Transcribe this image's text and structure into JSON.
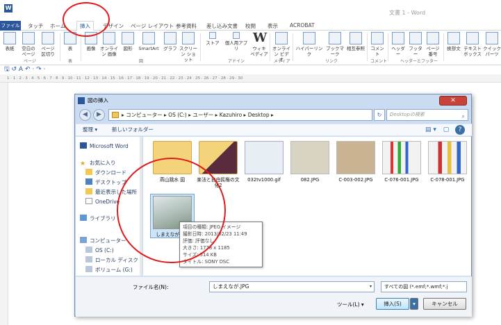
{
  "window": {
    "app_icon": "W",
    "title": "文書 1 - Word"
  },
  "tabs": [
    "ファイル",
    "タッチ",
    "ホーム",
    "挿入",
    "デザイン",
    "ページ レイアウト",
    "参考資料",
    "差し込み文書",
    "校閲",
    "表示",
    "ACROBAT"
  ],
  "active_tab": "挿入",
  "ribbon": {
    "buttons": [
      "表紙",
      "空白の ページ",
      "ページ 区切り",
      "表",
      "画像",
      "オンライン 画像",
      "図形",
      "SmartArt",
      "グラフ",
      "スクリーン ショット",
      "ストア",
      "個人用アプリ",
      "ウィキ ペディア",
      "オンライン ビデオ",
      "ハイパーリンク",
      "ブックマーク",
      "相互参照",
      "コメント",
      "ヘッダー",
      "フッター",
      "ページ 番号",
      "挨拶文",
      "テキスト ボックス",
      "クイック パーツ"
    ],
    "groups": [
      "ページ",
      "表",
      "図",
      "アドイン",
      "メディア",
      "リンク",
      "コメント",
      "ヘッダーとフッター"
    ]
  },
  "qat": "🖫 ↺ A ↶ · ↷ ·",
  "ruler": "1 · 1 · 2 · 3 · 4 · 5 · 6 · 7 · 8 · 9 · 10 · 11 · 12 · 13 · 14 · 15 · 16 · 17 · 18 · 19 · 20 · 21 · 22 · 23 · 24 · 25 · 26 · 27 · 28 · 29 · 30",
  "dialog": {
    "title": "図の挿入",
    "close": "✕",
    "nav_back": "◀",
    "nav_forward": "▶",
    "address": "▸ コンピューター ▸ OS (C:) ▸ ユーザー ▸ Kazuhiro ▸ Desktop ▸",
    "refresh": "↻",
    "search_placeholder": "Desktopの検索",
    "search_icon": "⌕",
    "toolbar": {
      "organize": "整理 ▾",
      "new_folder": "新しいフォルダー",
      "view": "▤ ▾",
      "pane": "▢",
      "help": "?"
    },
    "nav_pane": [
      {
        "label": "Microsoft Word",
        "icon": "word-icon"
      },
      {
        "label": "お気に入り",
        "icon": "star-icon"
      },
      {
        "label": "ダウンロード",
        "icon": "folder-icon"
      },
      {
        "label": "デスクトップ",
        "icon": "desktop-icon"
      },
      {
        "label": "最近表示した場所",
        "icon": "recent-icon"
      },
      {
        "label": "OneDrive",
        "icon": "cloud-icon"
      },
      {
        "label": "ライブラリ",
        "icon": "library-icon"
      },
      {
        "label": "コンピューター",
        "icon": "computer-icon"
      },
      {
        "label": "OS (C:)",
        "icon": "drive-icon"
      },
      {
        "label": "ローカル ディスク",
        "icon": "drive-icon"
      },
      {
        "label": "ボリューム (G:)",
        "icon": "drive-icon"
      }
    ],
    "files": [
      {
        "name": "燕山跳水 図",
        "kind": "folder"
      },
      {
        "name": "楽法と自由民権の文化2",
        "kind": "folder"
      },
      {
        "name": "032tv1000.gif",
        "kind": "gif"
      },
      {
        "name": "082.JPG",
        "kind": "jpg"
      },
      {
        "name": "C-003-002.JPG",
        "kind": "jpg"
      },
      {
        "name": "C-076-001.JPG",
        "kind": "jpg"
      },
      {
        "name": "C-078-001.JPG",
        "kind": "jpg"
      },
      {
        "name": "しまえなが.JPG",
        "kind": "jpg"
      }
    ],
    "tooltip": [
      "項目の種類: JPEG イメージ",
      "撮影日時: 2013/02/23 11:49",
      "評価: 評価なし",
      "大きさ: 1778 x 1185",
      "サイズ: 514 KB",
      "タイトル: SONY DSC"
    ],
    "filename_label": "ファイル名(N):",
    "filename_value": "しまえなが.JPG",
    "filter_value": "すべての図 (*.emf;*.wmf;*.j",
    "tools_label": "ツール(L) ▾",
    "insert_label": "挿入(S)",
    "insert_split": "▾",
    "cancel_label": "キャンセル",
    "dropdown_icon": "▾"
  },
  "colors": {
    "accent": "#2b579a",
    "annotation_circle": "#e0191b"
  }
}
